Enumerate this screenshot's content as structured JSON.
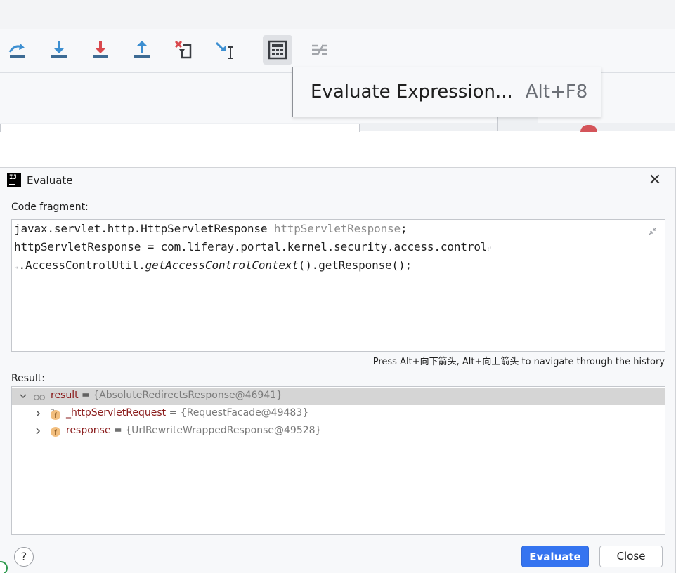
{
  "toolbar": {
    "icons": [
      "step-over-icon",
      "step-into-icon",
      "force-step-into-icon",
      "step-out-icon",
      "drop-frame-icon",
      "run-to-cursor-icon",
      "evaluate-expression-icon",
      "trace-icon"
    ],
    "tooltip_label": "Evaluate Expression...",
    "tooltip_shortcut": "Alt+F8"
  },
  "dialog": {
    "title": "Evaluate",
    "close_glyph": "✕",
    "code_fragment_label": "Code fragment:",
    "code": {
      "line1_a": "javax.servlet.http.HttpServletResponse ",
      "line1_b": "httpServletResponse",
      "line1_c": ";",
      "line2": "httpServletResponse = com.liferay.portal.kernel.security.access.control",
      "line3_a": ".AccessControlUtil.",
      "line3_b": "getAccessControlContext",
      "line3_c": "().getResponse();"
    },
    "history_hint": "Press Alt+向下箭头, Alt+向上箭头 to navigate through the history",
    "result_label": "Result:",
    "result_rows": [
      {
        "name": "result",
        "eq": " = ",
        "value": "{AbsoluteRedirectsResponse@46941}",
        "expanded": true
      },
      {
        "name": "_httpServletRequest",
        "eq": " = ",
        "value": "{RequestFacade@49483}",
        "expanded": false
      },
      {
        "name": "response",
        "eq": " = ",
        "value": "{UrlRewriteWrappedResponse@49528}",
        "expanded": false
      }
    ],
    "help_label": "?",
    "evaluate_label": "Evaluate",
    "close_label": "Close"
  },
  "colors": {
    "accent": "#3574f0",
    "field_name": "#8a1b1b",
    "value_gray": "#7a7a7a",
    "selection": "#d5d5d5"
  }
}
